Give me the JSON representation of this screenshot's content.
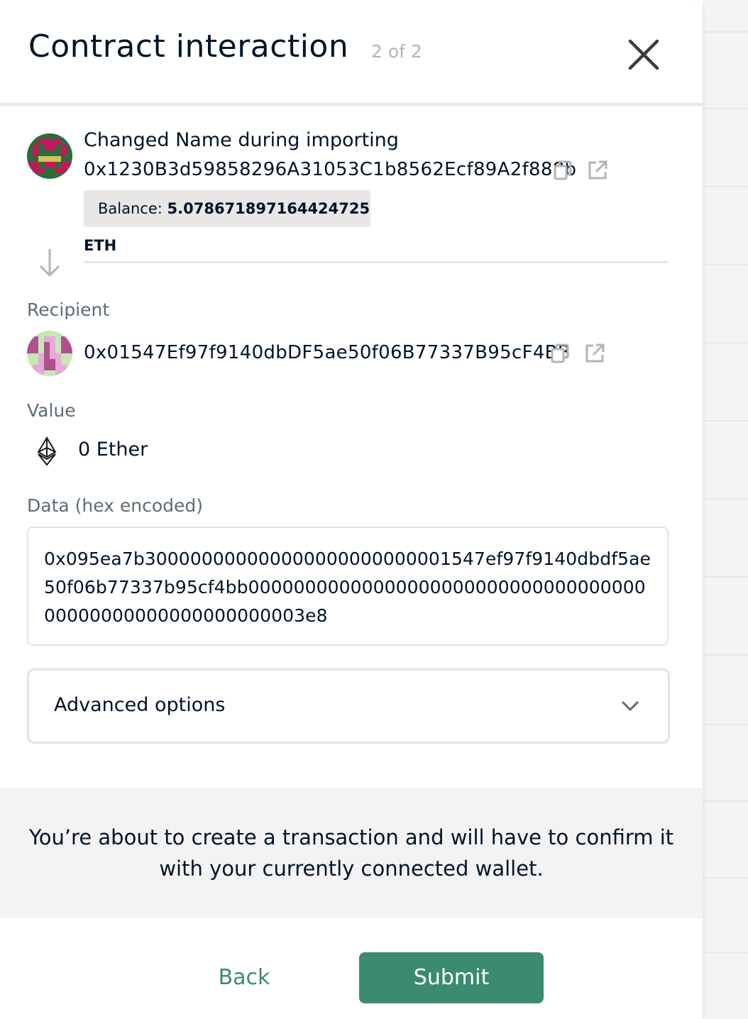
{
  "header": {
    "title": "Contract interaction",
    "step": "2 of 2",
    "close_icon": "close-icon"
  },
  "sender": {
    "name": "Changed Name during importing",
    "address": "0x1230B3d59858296A31053C1b8562Ecf89A2f888b",
    "balance_label": "Balance: ",
    "balance_value": "5.078671897164424725 ETH",
    "avatar_colors": [
      "#c2185b",
      "#2e6b3a",
      "#d4c25a"
    ]
  },
  "recipient": {
    "label": "Recipient",
    "address": "0x01547Ef97f9140dbDF5ae50f06B77337B95cF4BB",
    "avatar_colors": [
      "#e6a9d8",
      "#c7e8b5",
      "#b0508f"
    ]
  },
  "value": {
    "label": "Value",
    "amount": "0 Ether",
    "icon": "ethereum-icon"
  },
  "data_field": {
    "label": "Data (hex encoded)",
    "hex": "0x095ea7b300000000000000000000000001547ef97f9140dbdf5ae50f06b77337b95cf4bb0000000000000000000000000000000000000000000000000000000003e8"
  },
  "advanced": {
    "label": "Advanced options",
    "icon": "chevron-down-icon"
  },
  "notice": {
    "text": "You’re about to create a transaction and will have to confirm it with your currently connected wallet."
  },
  "actions": {
    "back_label": "Back",
    "submit_label": "Submit"
  },
  "colors": {
    "primary": "#3b8a72",
    "text": "#001428",
    "muted": "#5d6d74"
  }
}
